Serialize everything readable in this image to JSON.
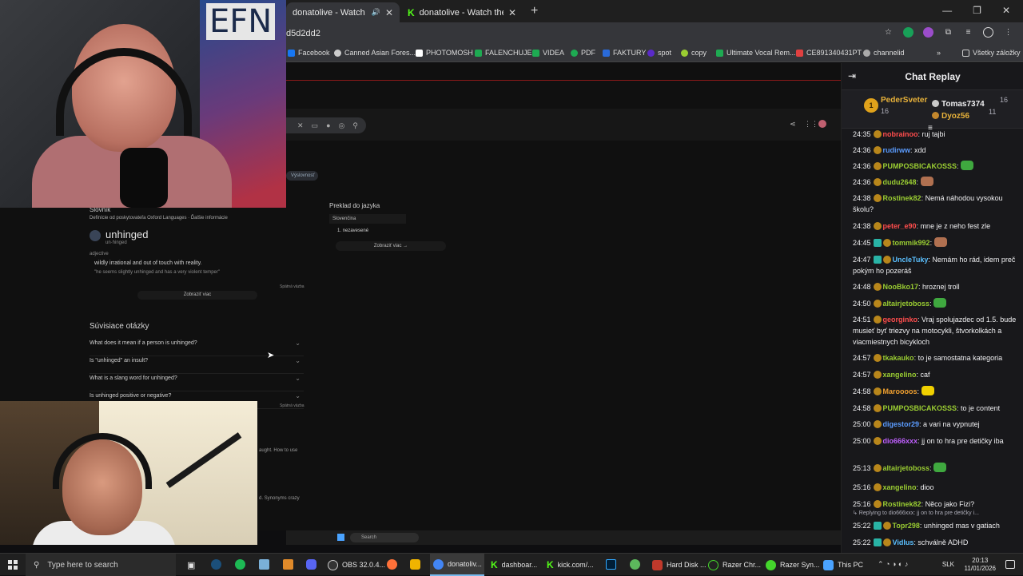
{
  "browser": {
    "tabs": [
      {
        "label": "donatolive - Watch the VOD",
        "active": true
      },
      {
        "label": "donatolive - Watch the VOD on",
        "active": false
      }
    ],
    "address": "d5d2dd2",
    "bookmarks": [
      "Facebook",
      "Canned Asian Fores...",
      "PHOTOMOSH",
      "FALENCHUJE",
      "VIDEA",
      "PDF",
      "FAKTURY",
      "spot",
      "copy",
      "Ultimate Vocal Rem...",
      "CE891340431PT",
      "channelid"
    ],
    "all_bookmarks": "Všetky záložky"
  },
  "page": {
    "chip": "Výslovnosť",
    "dict_label": "Slovník",
    "dict_source": "Definície od poskytovateľa Oxford Languages · Ďalšie informácie",
    "word": "unhinged",
    "phonetic": "un·hinged",
    "pos": "adjective",
    "definition": "wildly irrational and out of touch with reality.",
    "example": "\"he seems slightly unhinged and has a very violent temper\"",
    "feedback": "Spätná väzba",
    "show_more": "Zobraziť viac",
    "related_title": "Súvisiace otázky",
    "questions": [
      "What does it mean if a person is unhinged?",
      "Is \"unhinged\" an insult?",
      "What is a slang word for unhinged?",
      "Is unhinged positive or negative?"
    ],
    "feedback2": "Spätná väzba",
    "translate_title": "Preklad do jazyka",
    "translate_lang": "Slovenčina",
    "translate_item": "1. nezavesené",
    "translate_more": "Zobraziť viac →",
    "snippet1": "aught. How to use",
    "snippet2": "d. Synonyms crazy",
    "inner_search": "Search"
  },
  "chat": {
    "title": "Chat Replay",
    "leaderboard": {
      "first": {
        "rank": "1",
        "name": "PederSveter",
        "count": "16"
      },
      "second": {
        "name": "Tomas7374",
        "count": "16"
      },
      "third": {
        "name": "Dyoz56",
        "count": "11"
      }
    },
    "messages": [
      {
        "time": "24:35",
        "user": "nobrainoo",
        "color": "#ff4d4d",
        "text": "ruj tajbi"
      },
      {
        "time": "24:36",
        "user": "rudirww",
        "color": "#5b9cff",
        "text": "xdd"
      },
      {
        "time": "24:36",
        "user": "PUMPOSBICAKOSSS",
        "color": "#9acd32",
        "text": ""
      },
      {
        "time": "24:36",
        "user": "dudu2648",
        "color": "#9acd32",
        "text": ""
      },
      {
        "time": "24:38",
        "user": "Rostinek82",
        "color": "#9acd32",
        "text": "Nemá náhodou vysokou školu?"
      },
      {
        "time": "24:38",
        "user": "peter_e90",
        "color": "#ff4d4d",
        "text": "mne je z neho fest zle"
      },
      {
        "time": "24:45",
        "user": "tommik992",
        "color": "#9acd32",
        "text": ""
      },
      {
        "time": "24:47",
        "user": "UncleTuky",
        "color": "#5bc0ff",
        "text": "Nemám ho rád, idem preč pokým ho pozeráš"
      },
      {
        "time": "24:48",
        "user": "NooBko17",
        "color": "#9acd32",
        "text": "hroznej troll"
      },
      {
        "time": "24:50",
        "user": "altairjetoboss",
        "color": "#9acd32",
        "text": ""
      },
      {
        "time": "24:51",
        "user": "georginko",
        "color": "#ff4d4d",
        "text": "Vraj spolujazdec od 1.5. bude musieť byť triezvy na motocykli, štvorkolkách a viacmiestnych bicykloch"
      },
      {
        "time": "24:57",
        "user": "tkakauko",
        "color": "#9acd32",
        "text": "to je samostatna kategoria"
      },
      {
        "time": "24:57",
        "user": "xangelino",
        "color": "#9acd32",
        "text": "caf"
      },
      {
        "time": "24:58",
        "user": "Maroooos",
        "color": "#f0a030",
        "text": ""
      },
      {
        "time": "24:58",
        "user": "PUMPOSBICAKOSSS",
        "color": "#9acd32",
        "text": "to je content"
      },
      {
        "time": "25:00",
        "user": "digestor29",
        "color": "#5b9cff",
        "text": "a vari na vypnutej"
      },
      {
        "time": "25:00",
        "user": "dio666xxx",
        "color": "#c060ff",
        "text": "jj on to hra pre detičky iba"
      },
      {
        "time": "25:13",
        "user": "altairjetoboss",
        "color": "#9acd32",
        "text": ""
      },
      {
        "time": "25:16",
        "user": "xangelino",
        "color": "#9acd32",
        "text": "dioo"
      },
      {
        "time": "25:16",
        "user": "Rostinek82",
        "color": "#9acd32",
        "text": "Něco jako Fizi?"
      },
      {
        "time": "25:22",
        "user": "Topr298",
        "color": "#9acd32",
        "text": "unhinged mas v gatiach"
      },
      {
        "time": "25:22",
        "user": "Vidlus",
        "color": "#5bc0ff",
        "text": "schválně ADHD"
      }
    ],
    "reply_note": "Replying to dio666xxx: jj on to hra pre detičky i..."
  },
  "taskbar": {
    "search": "Type here to search",
    "apps": [
      "OBS 32.0.4...",
      "donatoliv...",
      "dashboar...",
      "kick.com/...",
      "Hard Disk ...",
      "Razer Chr...",
      "Razer Syn...",
      "This PC"
    ],
    "lang": "SLK",
    "time": "20:13",
    "date": "11/01/2026"
  }
}
